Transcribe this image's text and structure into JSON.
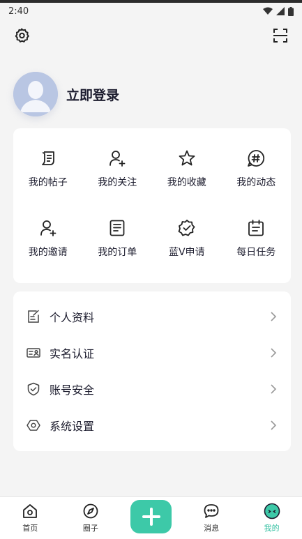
{
  "status_bar": {
    "time": "2:40"
  },
  "header": {
    "settings_icon": "gear-icon",
    "scan_icon": "scan-icon"
  },
  "profile": {
    "login_label": "立即登录"
  },
  "grid": {
    "items": [
      {
        "label": "我的帖子",
        "icon": "post-icon"
      },
      {
        "label": "我的关注",
        "icon": "follow-icon"
      },
      {
        "label": "我的收藏",
        "icon": "star-icon"
      },
      {
        "label": "我的动态",
        "icon": "hashtag-icon"
      },
      {
        "label": "我的邀请",
        "icon": "invite-icon"
      },
      {
        "label": "我的订单",
        "icon": "order-icon"
      },
      {
        "label": "蓝V申请",
        "icon": "badge-check-icon"
      },
      {
        "label": "每日任务",
        "icon": "calendar-icon"
      }
    ]
  },
  "list": {
    "items": [
      {
        "label": "个人资料",
        "icon": "edit-doc-icon"
      },
      {
        "label": "实名认证",
        "icon": "id-card-icon"
      },
      {
        "label": "账号安全",
        "icon": "shield-icon"
      },
      {
        "label": "系统设置",
        "icon": "settings-hex-icon"
      }
    ]
  },
  "tabbar": {
    "tabs": [
      {
        "label": "首页",
        "icon": "home-icon"
      },
      {
        "label": "圈子",
        "icon": "compass-icon"
      },
      {
        "label": "",
        "icon": "plus-icon"
      },
      {
        "label": "消息",
        "icon": "chat-icon"
      },
      {
        "label": "我的",
        "icon": "profile-face-icon"
      }
    ],
    "active": "我的"
  },
  "colors": {
    "accent": "#3dc9a8",
    "active_tab": "#2fbfa0",
    "text": "#1c1c2e",
    "background": "#f4f4f4"
  }
}
